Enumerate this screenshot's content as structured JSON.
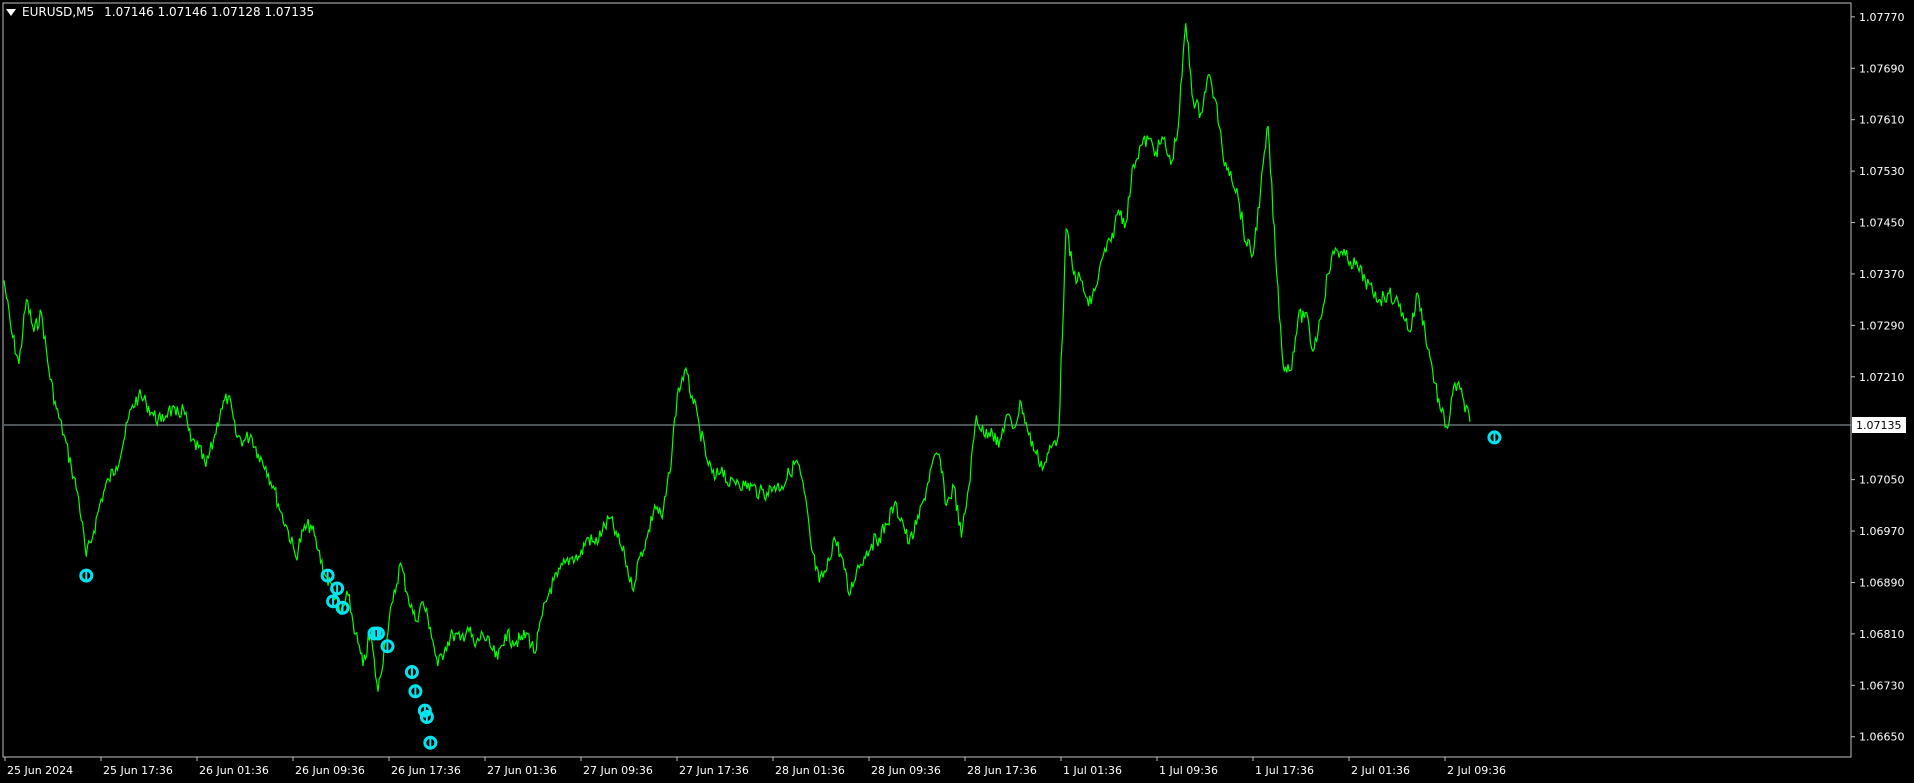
{
  "header": {
    "symbol": "EURUSD,M5",
    "ohlc": "1.07146 1.07146 1.07128 1.07135"
  },
  "colors": {
    "background": "#000000",
    "frame": "#c0c0c0",
    "price_line": "#99a8b0",
    "series": "#00ff00",
    "markers": "#00e5ee",
    "text": "#ffffff"
  },
  "chart_data": {
    "type": "line",
    "symbol": "EURUSD",
    "timeframe": "M5",
    "ylim": [
      1.0662,
      1.0779
    ],
    "grid": false,
    "y_ticks": [
      "1.07770",
      "1.07690",
      "1.07610",
      "1.07530",
      "1.07450",
      "1.07370",
      "1.07290",
      "1.07210",
      "1.07135",
      "1.07050",
      "1.06970",
      "1.06890",
      "1.06810",
      "1.06730",
      "1.06650"
    ],
    "x_ticks": [
      "25 Jun 2024",
      "25 Jun 17:36",
      "26 Jun 01:36",
      "26 Jun 09:36",
      "26 Jun 17:36",
      "27 Jun 01:36",
      "27 Jun 09:36",
      "27 Jun 17:36",
      "28 Jun 01:36",
      "28 Jun 09:36",
      "28 Jun 17:36",
      "1 Jul 01:36",
      "1 Jul 09:36",
      "1 Jul 17:36",
      "2 Jul 01:36",
      "2 Jul 09:36"
    ],
    "current_price": 1.07135,
    "current_price_label": "1.07135",
    "series": [
      {
        "values": [
          1.0736,
          1.0728,
          1.0723,
          1.0733,
          1.0728,
          1.0731,
          1.0722,
          1.0716,
          1.0712,
          1.0707,
          1.0702,
          1.0693,
          1.0697,
          1.0702,
          1.0705,
          1.0707,
          1.0711,
          1.0716,
          1.0718,
          1.0717,
          1.0715,
          1.0714,
          1.0716,
          1.0715,
          1.0716,
          1.0711,
          1.071,
          1.0707,
          1.0711,
          1.0716,
          1.0718,
          1.0712,
          1.0711,
          1.0712,
          1.0709,
          1.0707,
          1.0704,
          1.07,
          1.0697,
          1.0693,
          1.0697,
          1.0698,
          1.0694,
          1.069,
          1.0688,
          1.0684,
          1.0687,
          1.0681,
          1.0676,
          1.0681,
          1.0672,
          1.068,
          1.0686,
          1.0692,
          1.0687,
          1.0683,
          1.0686,
          1.0682,
          1.0676,
          1.0679,
          1.0681,
          1.068,
          1.0682,
          1.0679,
          1.0681,
          1.0679,
          1.0677,
          1.0681,
          1.068,
          1.068,
          1.0681,
          1.0678,
          1.0684,
          1.0688,
          1.069,
          1.0692,
          1.0693,
          1.0693,
          1.0696,
          1.0695,
          1.0697,
          1.0699,
          1.0696,
          1.0693,
          1.0688,
          1.0693,
          1.0696,
          1.0701,
          1.0699,
          1.0706,
          1.0718,
          1.0722,
          1.0718,
          1.0713,
          1.0708,
          1.0705,
          1.0707,
          1.0704,
          1.0705,
          1.0704,
          1.0704,
          1.0703,
          1.0703,
          1.0704,
          1.0704,
          1.0706,
          1.0708,
          1.0703,
          1.0694,
          1.0689,
          1.0691,
          1.0696,
          1.0693,
          1.0687,
          1.0691,
          1.0693,
          1.0695,
          1.0696,
          1.0698,
          1.0701,
          1.0699,
          1.0695,
          1.0698,
          1.0702,
          1.0707,
          1.0709,
          1.0701,
          1.0704,
          1.0696,
          1.0704,
          1.0715,
          1.0712,
          1.0713,
          1.071,
          1.0715,
          1.0713,
          1.0717,
          1.0712,
          1.0709,
          1.0707,
          1.071,
          1.0712,
          1.0744,
          1.0737,
          1.0736,
          1.0732,
          1.0735,
          1.074,
          1.0742,
          1.0747,
          1.0745,
          1.0754,
          1.0757,
          1.0758,
          1.0756,
          1.0758,
          1.0754,
          1.076,
          1.0776,
          1.0764,
          1.0762,
          1.0768,
          1.0764,
          1.0755,
          1.0753,
          1.0749,
          1.0742,
          1.074,
          1.075,
          1.076,
          1.074,
          1.0723,
          1.0722,
          1.073,
          1.0731,
          1.0725,
          1.073,
          1.0737,
          1.0741,
          1.074,
          1.0739,
          1.0738,
          1.0736,
          1.0734,
          1.0733,
          1.0734,
          1.0733,
          1.0731,
          1.0728,
          1.0734,
          1.0728,
          1.0722,
          1.0716,
          1.0713,
          1.072,
          1.0718,
          1.0714
        ]
      }
    ],
    "arrow_markers": [
      1.0691,
      1.0691,
      1.0689,
      1.0687,
      1.0686,
      1.0682,
      1.0682,
      1.068,
      1.0676,
      1.0673,
      1.067,
      1.0669,
      1.0665,
      1.07125
    ]
  }
}
